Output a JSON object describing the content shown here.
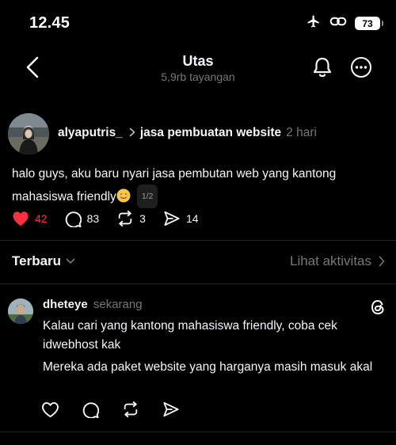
{
  "status_bar": {
    "time": "12.45",
    "battery": "73"
  },
  "nav": {
    "title": "Utas",
    "subtitle": "5,9rb tayangan"
  },
  "post": {
    "username": "alyaputris_",
    "community": "jasa pembuatan website",
    "time": "2 hari",
    "text_line1": "halo guys, aku baru nyari jasa pembutan web yang kantong",
    "text_line2": "mahasiswa friendly",
    "page_indicator": "1/2",
    "likes": "42",
    "comments": "83",
    "reposts": "3",
    "shares": "14"
  },
  "sort": {
    "label": "Terbaru",
    "activity": "Lihat aktivitas"
  },
  "reply": {
    "username": "dheteye",
    "time": "sekarang",
    "paragraph1": "Kalau cari yang kantong mahasiswa friendly, coba cek idwebhost kak",
    "paragraph2": "Mereka ada paket website yang harganya masih masuk akal"
  },
  "colors": {
    "like_red": "#ff3040",
    "muted": "#777777",
    "background": "#000000"
  },
  "icons": {
    "status": [
      "airplane-icon",
      "link-icon",
      "battery-icon"
    ],
    "post_actions": [
      "heart-icon",
      "comment-icon",
      "repost-icon",
      "share-icon"
    ],
    "nav": [
      "back-icon",
      "bell-icon",
      "more-icon"
    ]
  }
}
